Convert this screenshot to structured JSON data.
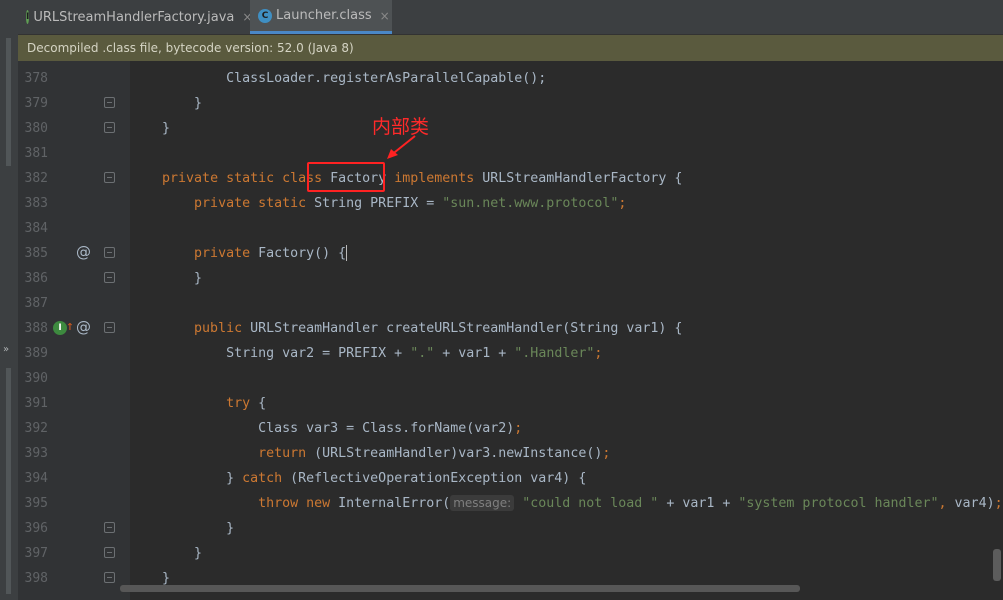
{
  "tabs": [
    {
      "label": "URLStreamHandlerFactory.java",
      "icon": "java-interface-icon",
      "close": "×",
      "active": false
    },
    {
      "label": "Launcher.class",
      "icon": "java-class-icon",
      "close": "×",
      "active": true
    }
  ],
  "info_bar": "Decompiled .class file, bytecode version: 52.0 (Java 8)",
  "annotation": "内部类",
  "gutter": {
    "at_glyph": "@",
    "implements_glyph": "I",
    "up_arrow_glyph": "↑",
    "expand_glyph": "»"
  },
  "lines": [
    {
      "n": "378",
      "segs": [
        [
          "t",
          "            ClassLoader.registerAsParallelCapable();"
        ]
      ]
    },
    {
      "n": "379",
      "segs": [
        [
          "t",
          "        }"
        ]
      ]
    },
    {
      "n": "380",
      "segs": [
        [
          "t",
          "    }"
        ]
      ]
    },
    {
      "n": "381",
      "segs": []
    },
    {
      "n": "382",
      "segs": [
        [
          "t",
          "    "
        ],
        [
          "k",
          "private static class "
        ],
        [
          "t",
          "Factory "
        ],
        [
          "k",
          "implements "
        ],
        [
          "t",
          "URLStreamHandlerFactory {"
        ]
      ]
    },
    {
      "n": "383",
      "segs": [
        [
          "t",
          "        "
        ],
        [
          "k",
          "private static "
        ],
        [
          "t",
          "String PREFIX = "
        ],
        [
          "s",
          "\"sun.net.www.protocol\""
        ],
        [
          "k",
          ";"
        ]
      ]
    },
    {
      "n": "384",
      "segs": []
    },
    {
      "n": "385",
      "segs": [
        [
          "t",
          "        "
        ],
        [
          "k",
          "private "
        ],
        [
          "t",
          "Factory() {"
        ]
      ]
    },
    {
      "n": "386",
      "segs": [
        [
          "t",
          "        }"
        ]
      ]
    },
    {
      "n": "387",
      "segs": []
    },
    {
      "n": "388",
      "segs": [
        [
          "t",
          "        "
        ],
        [
          "k",
          "public "
        ],
        [
          "t",
          "URLStreamHandler createURLStreamHandler(String var1) {"
        ]
      ]
    },
    {
      "n": "389",
      "segs": [
        [
          "t",
          "            String var2 = PREFIX + "
        ],
        [
          "s",
          "\".\""
        ],
        [
          "t",
          " + var1 + "
        ],
        [
          "s",
          "\".Handler\""
        ],
        [
          "k",
          ";"
        ]
      ]
    },
    {
      "n": "390",
      "segs": []
    },
    {
      "n": "391",
      "segs": [
        [
          "t",
          "            "
        ],
        [
          "k",
          "try "
        ],
        [
          "t",
          "{"
        ]
      ]
    },
    {
      "n": "392",
      "segs": [
        [
          "t",
          "                Class var3 = Class."
        ],
        [
          "t",
          "forName(var2)"
        ],
        [
          "k",
          ";"
        ]
      ]
    },
    {
      "n": "393",
      "segs": [
        [
          "t",
          "                "
        ],
        [
          "k",
          "return "
        ],
        [
          "t",
          "(URLStreamHandler)var3.newInstance()"
        ],
        [
          "k",
          ";"
        ]
      ]
    },
    {
      "n": "394",
      "segs": [
        [
          "t",
          "            } "
        ],
        [
          "k",
          "catch "
        ],
        [
          "t",
          "(ReflectiveOperationException var4) {"
        ]
      ]
    },
    {
      "n": "395",
      "segs": [
        [
          "t",
          "                "
        ],
        [
          "k",
          "throw new "
        ],
        [
          "t",
          "InternalError("
        ],
        [
          "h",
          "message:"
        ],
        [
          "s",
          " \"could not load \""
        ],
        [
          "t",
          " + var1 + "
        ],
        [
          "s",
          "\"system protocol handler\""
        ],
        [
          "k",
          ", "
        ],
        [
          "t",
          "var4)"
        ],
        [
          "k",
          ";"
        ]
      ]
    },
    {
      "n": "396",
      "segs": [
        [
          "t",
          "            }"
        ]
      ]
    },
    {
      "n": "397",
      "segs": [
        [
          "t",
          "        }"
        ]
      ]
    },
    {
      "n": "398",
      "segs": [
        [
          "t",
          "    }"
        ]
      ]
    }
  ],
  "colors": {
    "background": "#2b2b2b",
    "keyword": "#cc7832",
    "string": "#6a8759",
    "text": "#a9b7c6",
    "line_number": "#606366",
    "annotation_red": "#ff2222",
    "info_bar": "#5a5a3e",
    "active_tab_underline": "#4a88c7"
  }
}
